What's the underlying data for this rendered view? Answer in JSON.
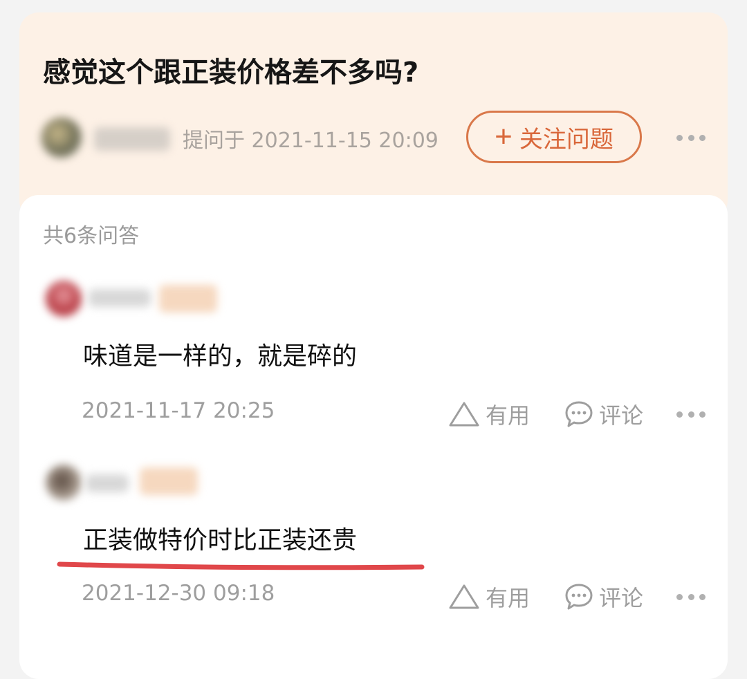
{
  "question": {
    "title": "感觉这个跟正装价格差不多吗?",
    "asked_time": "提问于 2021-11-15 20:09",
    "follow_label": "关注问题",
    "follow_icon": "plus-icon"
  },
  "answers_section": {
    "count_label": "共6条问答"
  },
  "answers": [
    {
      "text": "味道是一样的，就是碎的",
      "time": "2021-11-17 20:25",
      "useful_label": "有用",
      "comment_label": "评论"
    },
    {
      "text": "正装做特价时比正装还贵",
      "time": "2021-12-30 09:18",
      "useful_label": "有用",
      "comment_label": "评论"
    }
  ],
  "colors": {
    "accent": "#d9673a",
    "underline": "#e0474a",
    "question_bg": "#fdf1e6"
  }
}
